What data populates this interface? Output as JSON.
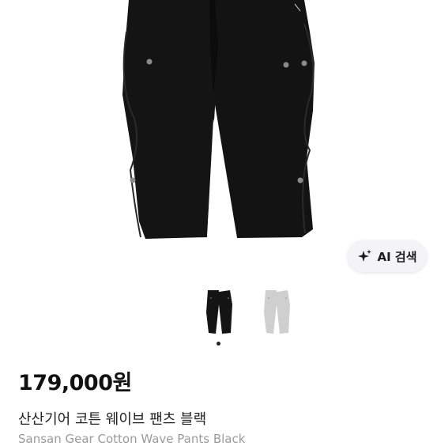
{
  "product": {
    "price": "179,000원",
    "title": "산산기어 코튼 웨이브 팬츠 블랙",
    "subtitle": "Sansan Gear Cotton Wave Pants Black"
  },
  "ai_search": {
    "label": "AI 검색",
    "icon": "sparkle-icon"
  },
  "gallery": {
    "selected_index": 1,
    "total": 2,
    "thumbnails": [
      {
        "color_name": "black",
        "color": "#141414"
      },
      {
        "color_name": "grey",
        "color": "#cfcfcf"
      }
    ]
  },
  "colors": {
    "pants_main": "#141414",
    "dot_active": "#222222",
    "dot_inactive": "#d0d0d0",
    "ai_button_bg": "#f4f4f6"
  }
}
